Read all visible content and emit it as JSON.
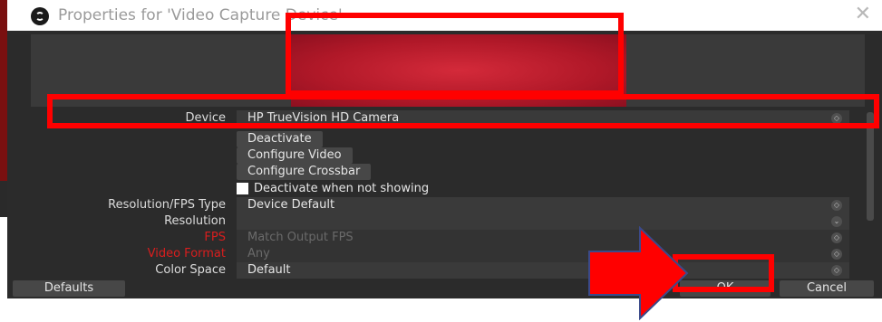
{
  "window": {
    "title": "Properties for 'Video Capture Device'",
    "close_glyph": "✕"
  },
  "device": {
    "label": "Device",
    "value": "HP TrueVision HD Camera"
  },
  "buttons": {
    "deactivate": "Deactivate",
    "configure_video": "Configure Video",
    "configure_crossbar": "Configure Crossbar"
  },
  "checkbox": {
    "label": "Deactivate when not showing",
    "checked": false
  },
  "fields": [
    {
      "label": "Resolution/FPS Type",
      "value": "Device Default",
      "disabled": false,
      "label_red": false
    },
    {
      "label": "Resolution",
      "value": "",
      "disabled": false,
      "label_red": false
    },
    {
      "label": "FPS",
      "value": "Match Output FPS",
      "disabled": true,
      "label_red": true
    },
    {
      "label": "Video Format",
      "value": "Any",
      "disabled": true,
      "label_red": true
    },
    {
      "label": "Color Space",
      "value": "Default",
      "disabled": false,
      "label_red": false
    }
  ],
  "footer": {
    "defaults": "Defaults",
    "ok": "OK",
    "cancel": "Cancel"
  },
  "colors": {
    "dialog_bg": "#2b2b2b",
    "annotation_red": "#ff0000",
    "arrow_fill": "#ff0000",
    "arrow_stroke": "#3b4a8a",
    "disabled_label": "#d91e1e"
  },
  "icons": {
    "app": "obs-logo-icon",
    "close": "close-icon",
    "spin": "updown-spin-icon",
    "annotation_arrow": "right-arrow-icon"
  }
}
